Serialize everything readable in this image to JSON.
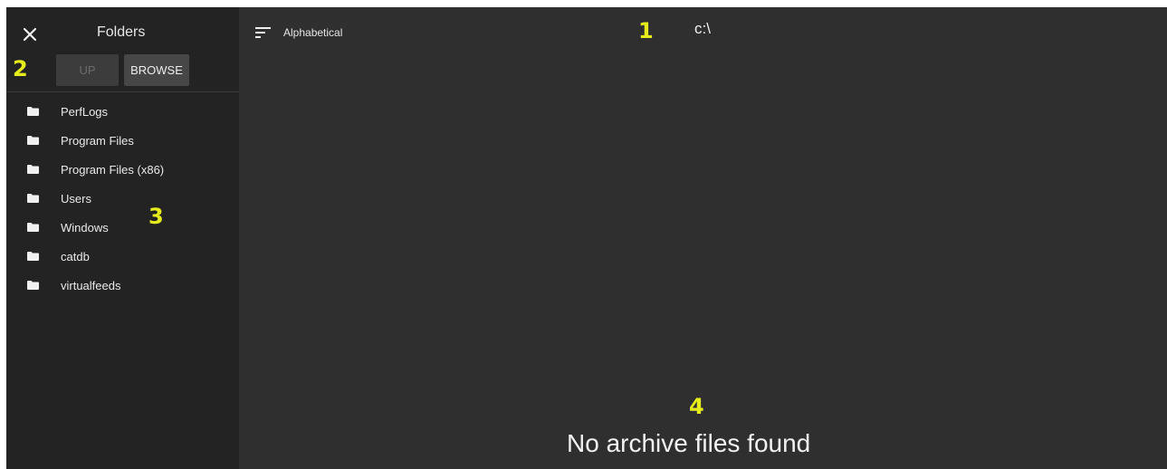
{
  "sidebar": {
    "title": "Folders",
    "up_label": "UP",
    "browse_label": "BROWSE",
    "folders": [
      {
        "label": "PerfLogs"
      },
      {
        "label": "Program Files"
      },
      {
        "label": "Program Files (x86)"
      },
      {
        "label": "Users"
      },
      {
        "label": "Windows"
      },
      {
        "label": "catdb"
      },
      {
        "label": "virtualfeeds"
      }
    ]
  },
  "toolbar": {
    "sort_label": "Alphabetical",
    "path": "c:\\"
  },
  "main": {
    "empty_message": "No archive files found"
  },
  "annotations": [
    "1",
    "2",
    "3",
    "4"
  ],
  "colors": {
    "sidebar_bg": "#232323",
    "main_bg": "#2f2f2f",
    "annotation": "#e6ec1c"
  }
}
